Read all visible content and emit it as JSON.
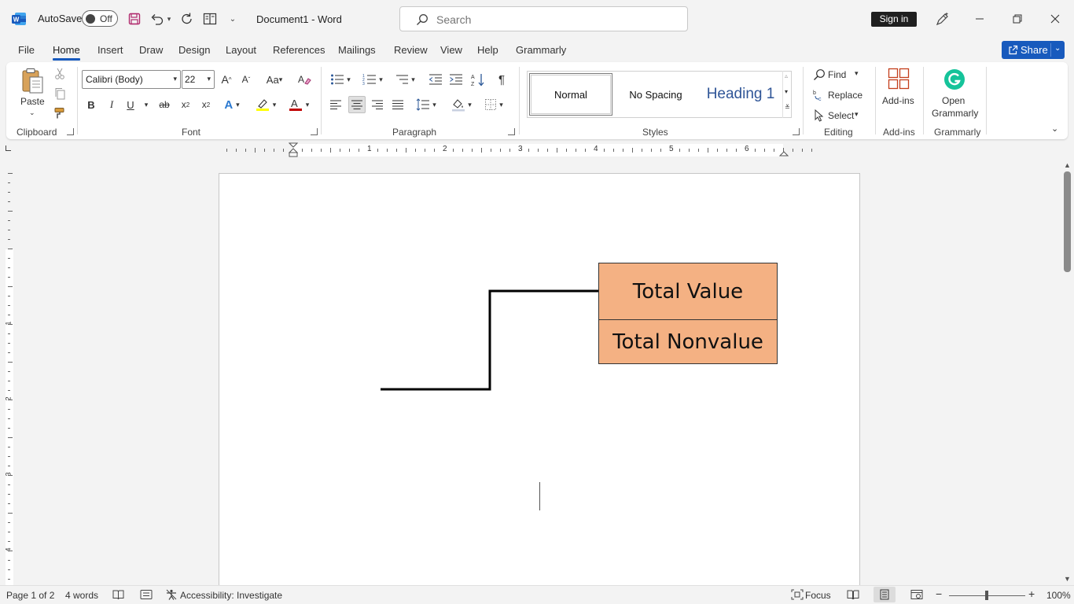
{
  "titlebar": {
    "autosave_label": "AutoSave",
    "autosave_state": "Off",
    "document_title": "Document1  -  Word",
    "search_placeholder": "Search",
    "signin_label": "Sign in"
  },
  "menu": {
    "tabs": [
      {
        "label": "File"
      },
      {
        "label": "Home",
        "active": true
      },
      {
        "label": "Insert"
      },
      {
        "label": "Draw"
      },
      {
        "label": "Design"
      },
      {
        "label": "Layout"
      },
      {
        "label": "References"
      },
      {
        "label": "Mailings"
      },
      {
        "label": "Review"
      },
      {
        "label": "View"
      },
      {
        "label": "Help"
      },
      {
        "label": "Grammarly"
      }
    ],
    "share_label": "Share"
  },
  "ribbon": {
    "clipboard": {
      "label": "Clipboard",
      "paste_label": "Paste"
    },
    "font": {
      "label": "Font",
      "font_name": "Calibri (Body)",
      "font_size": "22"
    },
    "paragraph": {
      "label": "Paragraph"
    },
    "styles": {
      "label": "Styles",
      "items": [
        "Normal",
        "No Spacing",
        "Heading 1"
      ]
    },
    "editing": {
      "label": "Editing",
      "find_label": "Find",
      "replace_label": "Replace",
      "select_label": "Select"
    },
    "addins": {
      "label": "Add-ins",
      "button_label": "Add-ins"
    },
    "grammarly": {
      "label": "Grammarly",
      "button_line1": "Open",
      "button_line2": "Grammarly"
    }
  },
  "ruler": {
    "numbers": [
      "1",
      "2",
      "3",
      "4",
      "5",
      "6"
    ],
    "vnumbers": [
      "1",
      "2",
      "3",
      "4"
    ]
  },
  "document": {
    "box_top_text": "Total Value",
    "box_bottom_text": "Total Nonvalue"
  },
  "statusbar": {
    "page_info": "Page 1 of 2",
    "word_count": "4 words",
    "accessibility": "Accessibility: Investigate",
    "focus_label": "Focus",
    "zoom_level": "100%"
  },
  "colors": {
    "accent": "#185abd",
    "box_fill": "#f4b183",
    "grammarly_green": "#15c39a",
    "addins_red": "#c43e1c"
  }
}
